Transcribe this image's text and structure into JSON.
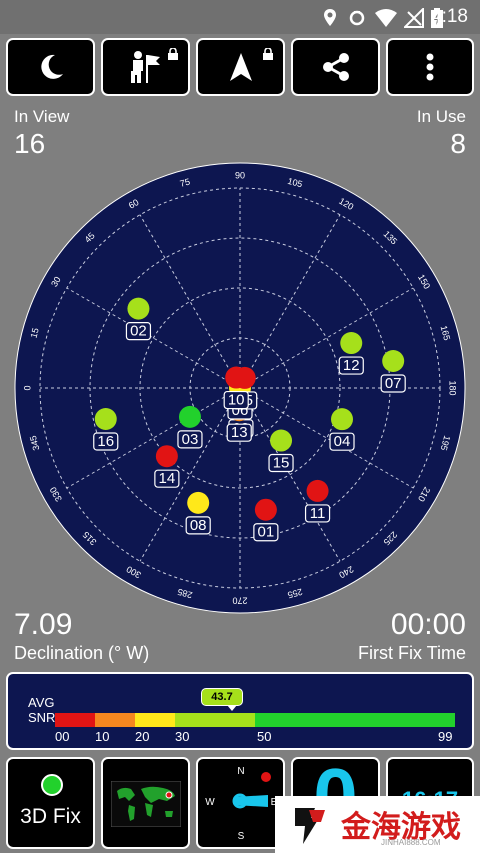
{
  "status_bar": {
    "time": "4:18"
  },
  "toolbar": {
    "buttons": [
      {
        "icon": "moon-icon"
      },
      {
        "icon": "person-flag-icon",
        "locked": true
      },
      {
        "icon": "navigation-arrow-icon",
        "locked": true
      },
      {
        "icon": "share-icon"
      },
      {
        "icon": "more-vert-icon"
      }
    ]
  },
  "stats": {
    "in_view_label": "In View",
    "in_view_value": "16",
    "in_use_label": "In Use",
    "in_use_value": "8",
    "declination_value": "7.09",
    "declination_label": "Declination (° W)",
    "first_fix_value": "00:00",
    "first_fix_label": "First Fix Time"
  },
  "sky": {
    "azimuth_labels": [
      "90",
      "105",
      "120",
      "135",
      "150",
      "165",
      "180",
      "195",
      "210",
      "225",
      "240",
      "255",
      "270",
      "285",
      "300",
      "315",
      "330",
      "345",
      "0",
      "15",
      "30",
      "45",
      "60",
      "75"
    ],
    "satellites": [
      {
        "id": "02",
        "azimuth": 38,
        "elevation": 32,
        "color": "#a6e01b"
      },
      {
        "id": "07",
        "azimuth": 170,
        "elevation": 20,
        "color": "#a6e01b"
      },
      {
        "id": "12",
        "azimuth": 158,
        "elevation": 36,
        "color": "#a6e01b"
      },
      {
        "id": "04",
        "azimuth": 197,
        "elevation": 42,
        "color": "#a6e01b"
      },
      {
        "id": "16",
        "azimuth": 347,
        "elevation": 28,
        "color": "#a6e01b"
      },
      {
        "id": "03",
        "azimuth": 330,
        "elevation": 64,
        "color": "#22d12c"
      },
      {
        "id": "14",
        "azimuth": 317,
        "elevation": 45,
        "color": "#e11414"
      },
      {
        "id": "15",
        "azimuth": 232,
        "elevation": 60,
        "color": "#a6e01b"
      },
      {
        "id": "11",
        "azimuth": 233,
        "elevation": 32,
        "color": "#e11414"
      },
      {
        "id": "01",
        "azimuth": 258,
        "elevation": 34,
        "color": "#e11414"
      },
      {
        "id": "08",
        "azimuth": 290,
        "elevation": 35,
        "color": "#ffe81a"
      },
      {
        "id": "09",
        "azimuth": 267,
        "elevation": 82,
        "color": "#22d12c"
      },
      {
        "id": "13",
        "azimuth": 272,
        "elevation": 80,
        "color": "#f5871f"
      },
      {
        "id": "06",
        "azimuth": 0,
        "elevation": 90,
        "color": "#ffe81a"
      },
      {
        "id": "05",
        "azimuth": 115,
        "elevation": 85,
        "color": "#e11414"
      },
      {
        "id": "10",
        "azimuth": 70,
        "elevation": 85,
        "color": "#e11414"
      }
    ]
  },
  "snr": {
    "avg_label": "AVG",
    "snr_label": "SNR",
    "avg_value": "43.7",
    "ticks": [
      "00",
      "10",
      "20",
      "30",
      "50",
      "99"
    ]
  },
  "bottom": {
    "fix_label": "3D Fix",
    "compass_letters": [
      "N",
      "W",
      "E",
      "S"
    ],
    "speed_digit": "0",
    "clock": "16:17"
  },
  "colors": {
    "background": "#7f7f7f",
    "panel": "#000000",
    "sky": "#0d1650",
    "accent_cyan": "#19c6ec"
  },
  "watermark": {
    "text": "金海游戏",
    "url": "JINHAI888.COM"
  }
}
